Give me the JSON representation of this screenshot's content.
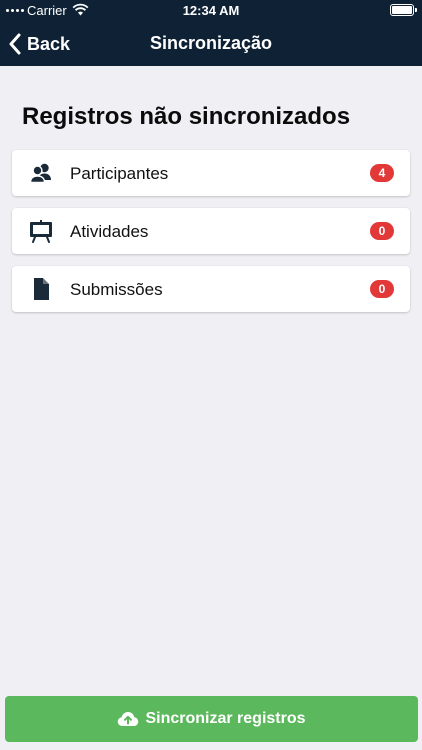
{
  "status_bar": {
    "carrier": "Carrier",
    "time": "12:34 AM"
  },
  "nav": {
    "back_label": "Back",
    "title": "Sincronização"
  },
  "section": {
    "title": "Registros não sincronizados"
  },
  "items": [
    {
      "label": "Participantes",
      "count": "4",
      "icon": "participants-icon"
    },
    {
      "label": "Atividades",
      "count": "0",
      "icon": "presentation-board-icon"
    },
    {
      "label": "Submissões",
      "count": "0",
      "icon": "document-icon"
    }
  ],
  "sync_button": {
    "label": "Sincronizar registros",
    "icon": "cloud-upload-icon"
  },
  "colors": {
    "header": "#0f2235",
    "background": "#efeff4",
    "badge": "#e23838",
    "button": "#5cb85c",
    "icon": "#1b2a38"
  }
}
